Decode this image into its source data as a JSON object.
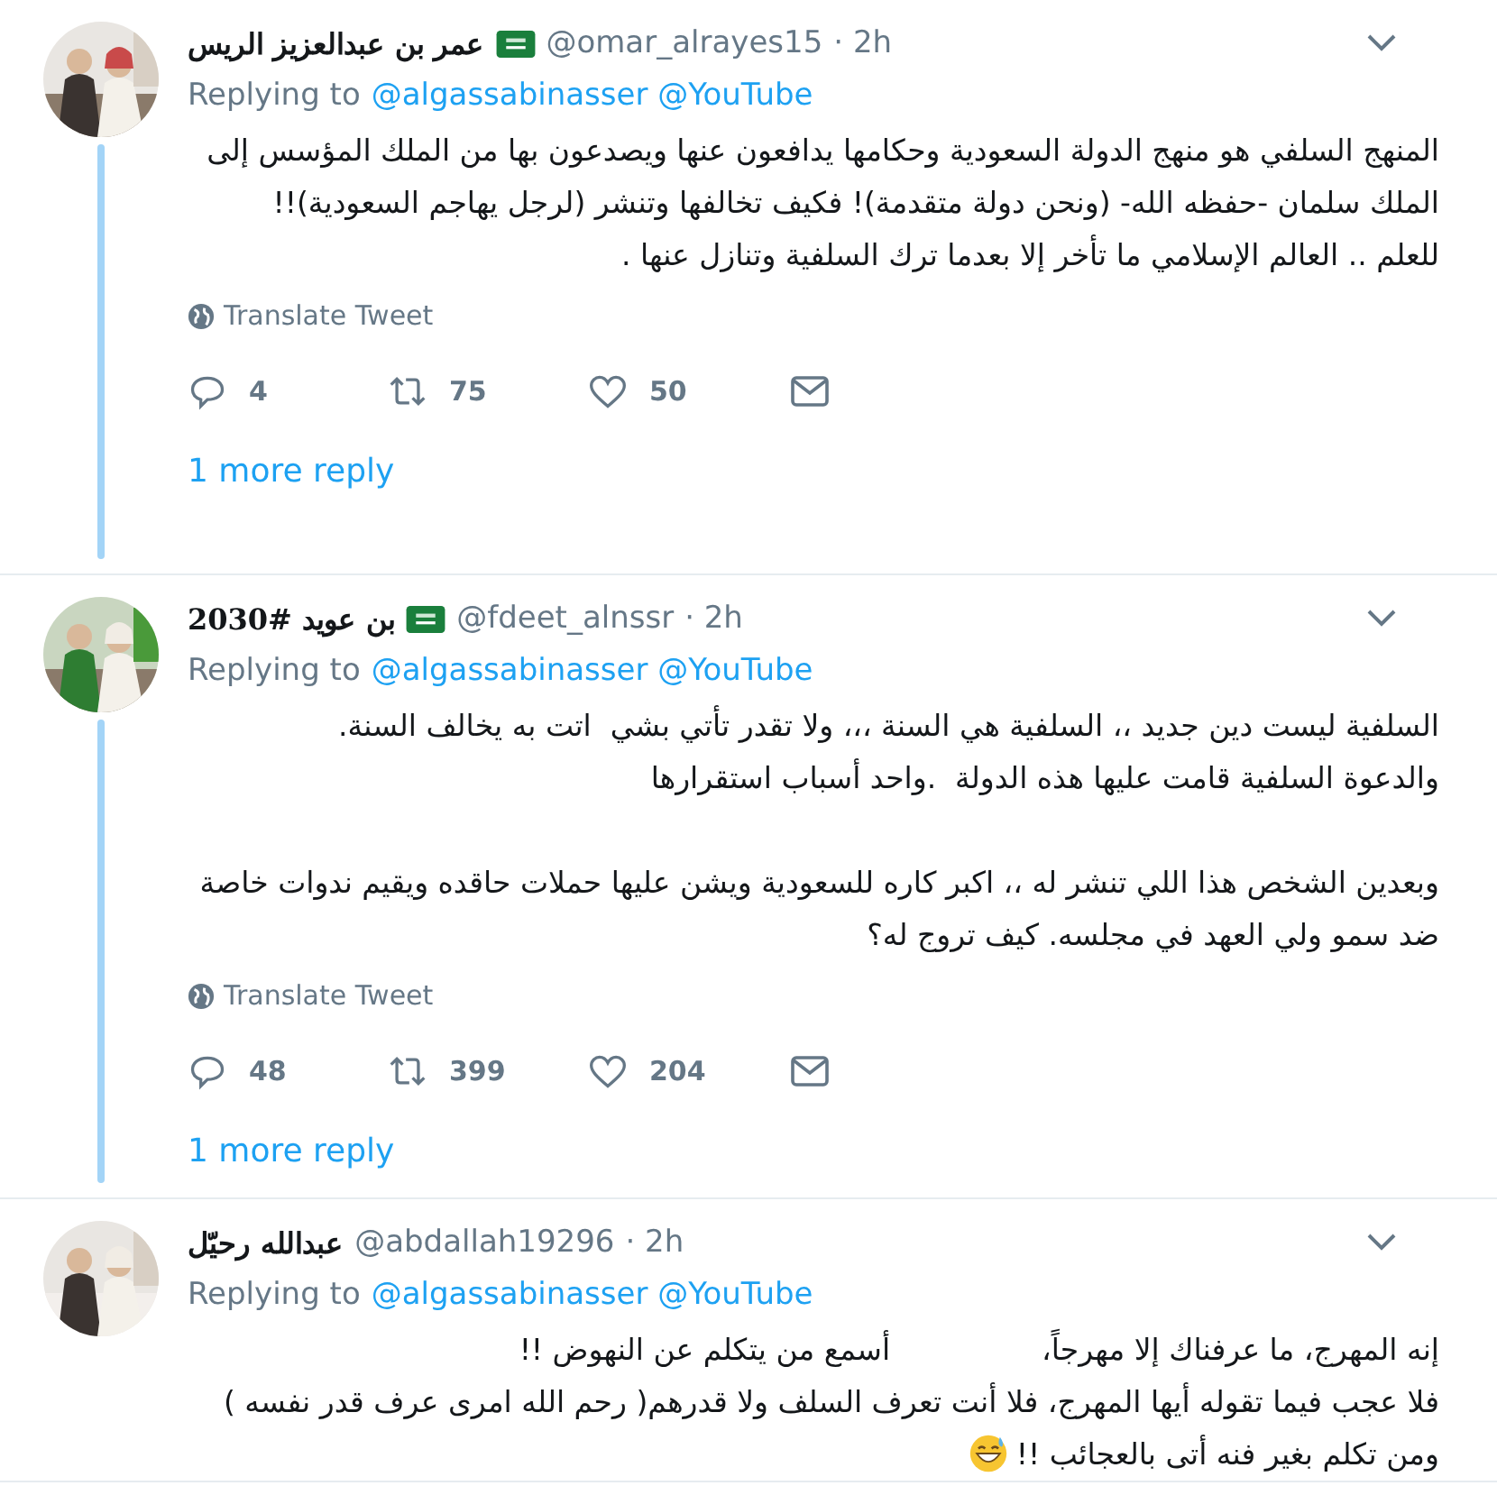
{
  "tweets": [
    {
      "name": "عمر بن عبدالعزيز الريس",
      "verified_flag": true,
      "handle": "@omar_alrayes15",
      "time": "· 2h",
      "replying_label": "Replying to",
      "replying_to": "@algassabinasser @YouTube",
      "thread": true,
      "avatar": {
        "kind": "picture"
      },
      "body": [
        "المنهج السلفي هو منهج الدولة السعودية وحكامها يدافعون عنها ويصدعون بها من الملك المؤسس إلى الملك سلمان -حفظه الله- (ونحن دولة متقدمة)! فكيف تخالفها وتنشر (لرجل يهاجم السعودية)!!",
        "للعلم .. العالم الإسلامي ما تأخر إلا بعدما ترك السلفية وتنازل عنها ."
      ],
      "translate": "Translate Tweet",
      "stats": {
        "replies": "4",
        "retweets": "75",
        "likes": "50"
      },
      "more": "1 more reply"
    },
    {
      "name": "بن عويد #2030",
      "verified_flag": true,
      "handle": "@fdeet_alnssr",
      "time": "· 2h",
      "replying_label": "Replying to",
      "replying_to": "@algassabinasser @YouTube",
      "thread": true,
      "avatar": {
        "kind": "picture"
      },
      "body": [
        "السلفية ليست دين جديد ،، السلفية هي السنة ،،، ولا تقدر تأتي بشي  اتت به يخالف السنة.",
        "والدعوة السلفية قامت عليها هذه الدولة  .واحد أسباب استقرارها",
        "وبعدين الشخص هذا اللي تنشر له ،، اكبر كاره للسعودية ويشن عليها حملات حاقده ويقيم ندوات خاصة ضد سمو ولي العهد في مجلسه. كيف تروج له؟"
      ],
      "translate": "Translate Tweet",
      "stats": {
        "replies": "48",
        "retweets": "399",
        "likes": "204"
      },
      "more": "1 more reply"
    },
    {
      "name": "عبدالله رحيّل",
      "verified_flag": false,
      "handle": "@abdallah19296",
      "time": "· 2h",
      "replying_label": "Replying to",
      "replying_to": "@algassabinasser @YouTube",
      "thread": false,
      "avatar": {
        "kind": "picture"
      },
      "body": [
        "إنه المهرج، ما عرفناك إلا مهرجاً،                أسمع من يتكلم عن النهوض !!",
        "فلا عجب فيما تقوله أيها المهرج، فلا أنت تعرف السلف ولا قدرهم( رحم الله امرى عرف قدر نفسه ) ومن تكلم بغير فنه أتى بالعجائب !!"
      ]
    }
  ]
}
